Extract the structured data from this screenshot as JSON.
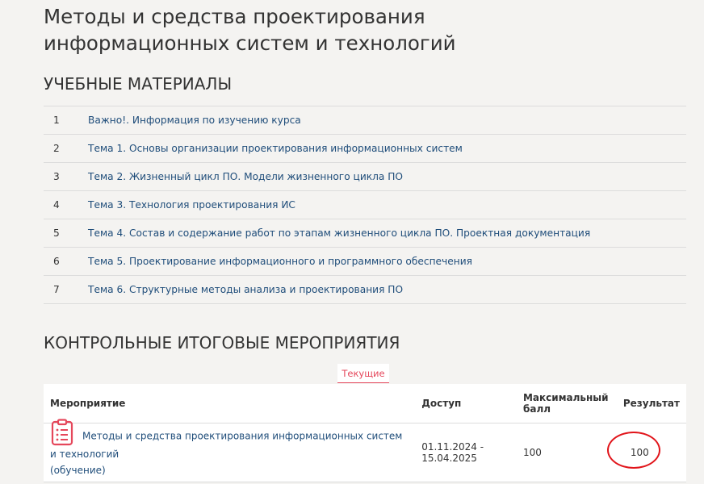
{
  "course": {
    "title_line1": "Методы и средства проектирования",
    "title_line2": "информационных систем и технологий"
  },
  "materials": {
    "heading": "УЧЕБНЫЕ МАТЕРИАЛЫ",
    "items": [
      {
        "num": "1",
        "label": "Важно!. Информация по изучению курса"
      },
      {
        "num": "2",
        "label": "Тема 1. Основы организации проектирования информационных систем"
      },
      {
        "num": "3",
        "label": "Тема 2. Жизненный цикл ПО. Модели жизненного цикла ПО"
      },
      {
        "num": "4",
        "label": "Тема 3. Технология проектирования ИС"
      },
      {
        "num": "5",
        "label": "Тема 4. Состав и содержание работ по этапам жизненного цикла ПО. Проектная документация"
      },
      {
        "num": "6",
        "label": "Тема 5. Проектирование информационного и программного обеспечения"
      },
      {
        "num": "7",
        "label": "Тема 6. Структурные методы анализа и проектирования ПО"
      }
    ]
  },
  "events": {
    "heading": "КОНТРОЛЬНЫЕ ИТОГОВЫЕ МЕРОПРИЯТИЯ",
    "tab_current": "Текущие",
    "columns": {
      "event": "Мероприятие",
      "access": "Доступ",
      "max_score_line1": "Максимальный",
      "max_score_line2": "балл",
      "result": "Результат"
    },
    "rows": [
      {
        "icon": "clipboard-list-icon",
        "title": "Методы и средства проектирования информационных систем и технологий",
        "subtitle": "(обучение)",
        "access_line1": "01.11.2024 -",
        "access_line2": "15.04.2025",
        "max_score": "100",
        "result": "100"
      }
    ]
  },
  "colors": {
    "link": "#1f4d7a",
    "accent": "#e5475b",
    "annotation_circle": "#e1141a",
    "background": "#f4f3f1"
  }
}
